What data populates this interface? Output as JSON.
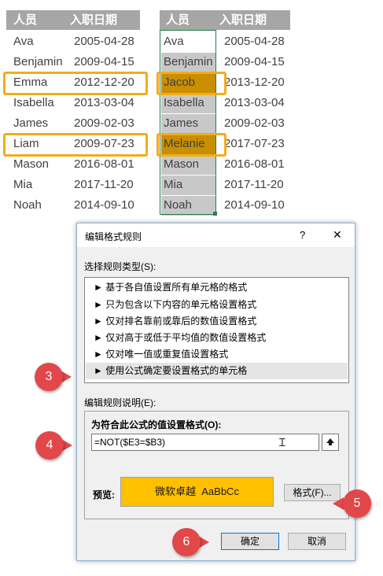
{
  "table_left": {
    "headers": [
      "人员",
      "入职日期"
    ],
    "rows": [
      [
        "Ava",
        "2005-04-28"
      ],
      [
        "Benjamin",
        "2009-04-15"
      ],
      [
        "Emma",
        "2012-12-20"
      ],
      [
        "Isabella",
        "2013-03-04"
      ],
      [
        "James",
        "2009-02-03"
      ],
      [
        "Liam",
        "2009-07-23"
      ],
      [
        "Mason",
        "2016-08-01"
      ],
      [
        "Mia",
        "2017-11-20"
      ],
      [
        "Noah",
        "2014-09-10"
      ]
    ]
  },
  "table_right": {
    "headers": [
      "人员",
      "入职日期"
    ],
    "rows": [
      [
        "Ava",
        "2005-04-28"
      ],
      [
        "Benjamin",
        "2009-04-15"
      ],
      [
        "Jacob",
        "2013-12-20"
      ],
      [
        "Isabella",
        "2013-03-04"
      ],
      [
        "James",
        "2009-02-03"
      ],
      [
        "Melanie",
        "2017-07-23"
      ],
      [
        "Mason",
        "2016-08-01"
      ],
      [
        "Mia",
        "2017-11-20"
      ],
      [
        "Noah",
        "2014-09-10"
      ]
    ]
  },
  "dialog": {
    "title": "编辑格式规则",
    "help_glyph": "?",
    "close_glyph": "✕",
    "rule_type_label": "选择规则类型(S):",
    "rule_types": [
      "► 基于各自值设置所有单元格的格式",
      "► 只为包含以下内容的单元格设置格式",
      "► 仅对排名靠前或靠后的数值设置格式",
      "► 仅对高于或低于平均值的数值设置格式",
      "► 仅对唯一值或重复值设置格式",
      "► 使用公式确定要设置格式的单元格"
    ],
    "edit_desc_label": "编辑规则说明(E):",
    "formula_label": "为符合此公式的值设置格式(O):",
    "formula_value": "=NOT($E3=$B3)",
    "preview_label": "预览:",
    "preview_text": "微软卓越  AaBbCc",
    "format_button": "格式(F)...",
    "ok_button": "确定",
    "cancel_button": "取消"
  },
  "badges": [
    "3",
    "4",
    "5",
    "6"
  ],
  "colors": {
    "header_gray": "#a6a6a6",
    "highlight_orange": "#f0ad1b",
    "gold_fill": "#c98f00",
    "preview_fill": "#ffc000",
    "badge_red": "#e2474a",
    "selection_green": "#2e7d4f"
  }
}
